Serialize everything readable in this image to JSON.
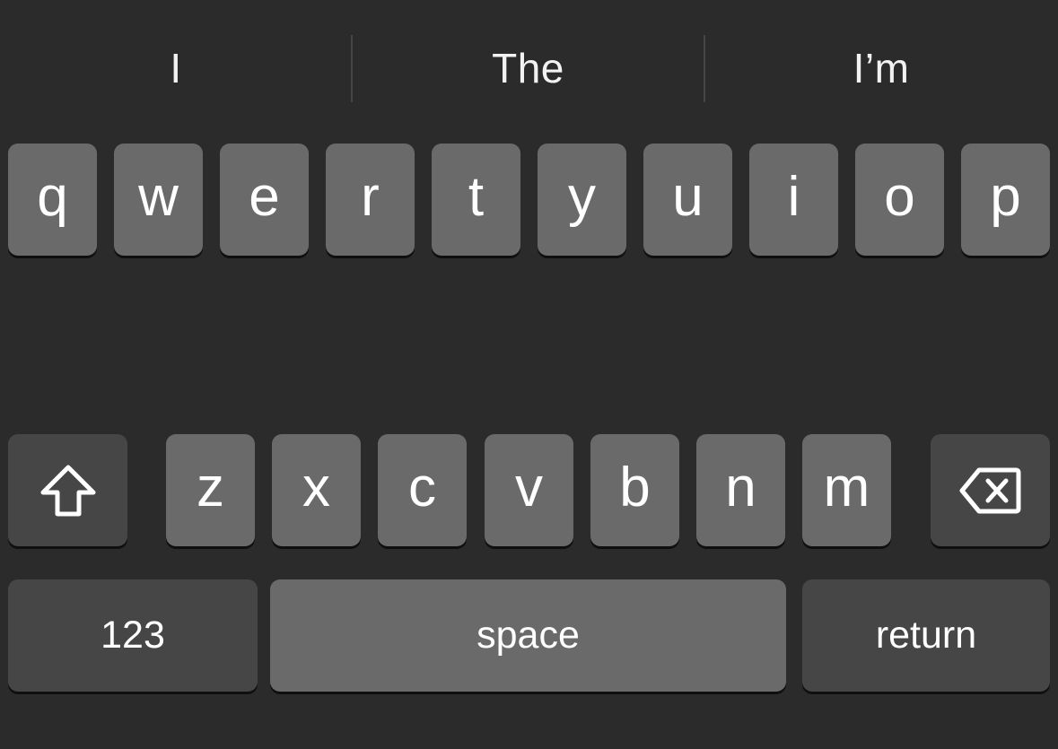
{
  "suggestions": [
    "I",
    "The",
    "I’m"
  ],
  "rows": {
    "top": [
      "q",
      "w",
      "e",
      "r",
      "t",
      "y",
      "u",
      "i",
      "o",
      "p"
    ],
    "bottom": [
      "z",
      "x",
      "c",
      "v",
      "b",
      "n",
      "m"
    ]
  },
  "keys": {
    "shift_icon": "shift-icon",
    "delete_icon": "delete-icon",
    "numbers_label": "123",
    "space_label": "space",
    "return_label": "return"
  },
  "colors": {
    "background": "#2b2b2b",
    "letter_key": "#6a6a6a",
    "function_key": "#464646",
    "text": "#ffffff"
  }
}
